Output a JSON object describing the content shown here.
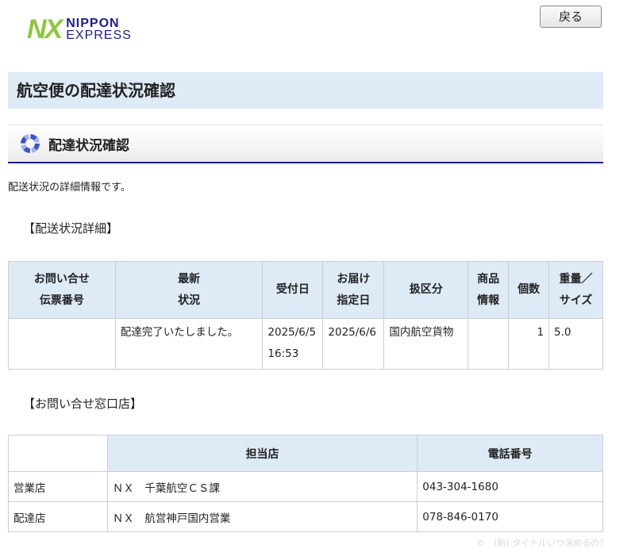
{
  "header": {
    "logo_mark": "NX",
    "logo_line1": "NIPPON",
    "logo_line2": "EXPRESS",
    "back_label": "戻る"
  },
  "page_title": "航空便の配達状況確認",
  "section": {
    "title": "配達状況確認",
    "intro": "配送状況の詳細情報です。"
  },
  "detail": {
    "heading": "【配送状況詳細】",
    "columns": [
      "お問い合せ\n伝票番号",
      "最新\n状況",
      "受付日",
      "お届け\n指定日",
      "扱区分",
      "商品\n情報",
      "個数",
      "重量／\nサイズ"
    ],
    "row": {
      "tracking_no": "",
      "status": "配達完了いたしました。",
      "received": "2025/6/5\n16:53",
      "delivery_date": "2025/6/6",
      "category": "国内航空貨物",
      "product_info": "",
      "count": "1",
      "weight_size": "5.0"
    }
  },
  "contact": {
    "heading": "【お問い合せ窓口店】",
    "columns": [
      "",
      "担当店",
      "電話番号"
    ],
    "rows": [
      {
        "type": "営業店",
        "store": "ＮＸ　千葉航空ＣＳ課",
        "phone": "043-304-1680"
      },
      {
        "type": "配達店",
        "store": "ＮＸ　航営神戸国内営業",
        "phone": "078-846-0170"
      }
    ]
  },
  "footer": "©　(新) タイトルいつ決めるの？"
}
